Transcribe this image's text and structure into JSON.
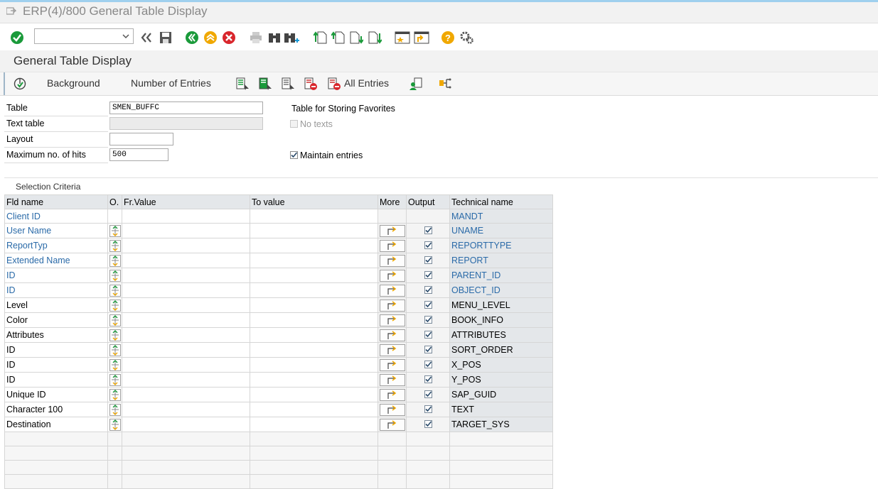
{
  "window": {
    "title": "ERP(4)/800 General Table Display"
  },
  "page": {
    "title": "General Table Display"
  },
  "app_toolbar": {
    "background_label": "Background",
    "number_of_entries_label": "Number of Entries",
    "all_entries_label": "All Entries"
  },
  "form": {
    "table_label": "Table",
    "table_value": "SMEN_BUFFC",
    "table_desc": "Table for Storing Favorites",
    "text_table_label": "Text table",
    "no_texts_label": "No texts",
    "layout_label": "Layout",
    "max_hits_label": "Maximum no. of hits",
    "max_hits_value": "500",
    "maintain_entries_label": "Maintain entries"
  },
  "selection": {
    "section_label": "Selection Criteria",
    "headers": [
      "Fld name",
      "O.",
      "Fr.Value",
      "To value",
      "More",
      "Output",
      "Technical name"
    ],
    "rows": [
      {
        "fld": "Client ID",
        "tech": "MANDT"
      },
      {
        "fld": "User Name",
        "tech": "UNAME"
      },
      {
        "fld": "ReportTyp",
        "tech": "REPORTTYPE"
      },
      {
        "fld": "Extended Name",
        "tech": "REPORT"
      },
      {
        "fld": "ID",
        "tech": "PARENT_ID"
      },
      {
        "fld": "ID",
        "tech": "OBJECT_ID"
      },
      {
        "fld": "Level",
        "tech": "MENU_LEVEL"
      },
      {
        "fld": "Color",
        "tech": "BOOK_INFO"
      },
      {
        "fld": "Attributes",
        "tech": "ATTRIBUTES"
      },
      {
        "fld": "ID",
        "tech": "SORT_ORDER"
      },
      {
        "fld": "ID",
        "tech": "X_POS"
      },
      {
        "fld": "ID",
        "tech": "Y_POS"
      },
      {
        "fld": "Unique ID",
        "tech": "SAP_GUID"
      },
      {
        "fld": "Character 100",
        "tech": "TEXT"
      },
      {
        "fld": "Destination",
        "tech": "TARGET_SYS"
      }
    ]
  },
  "colors": {
    "key_field_blue": "#2a6aa8",
    "header_gray": "#e4e7ea",
    "accent_green": "#1a9a3a"
  }
}
